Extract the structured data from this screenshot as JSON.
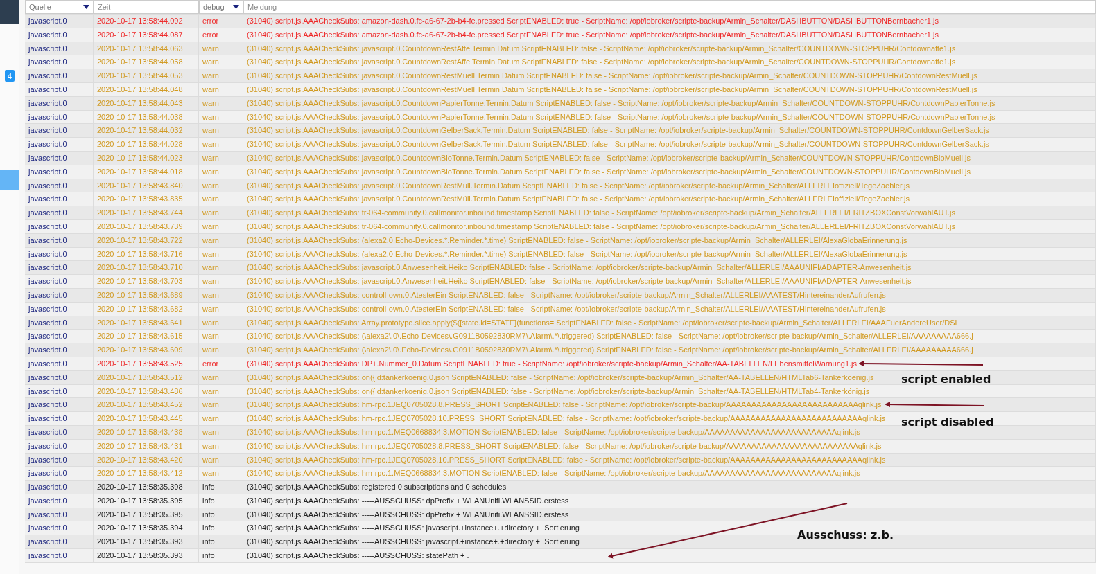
{
  "sidebar": {
    "badge": "4"
  },
  "filters": [
    {
      "kind": "select",
      "value": "Quelle"
    },
    {
      "kind": "input",
      "placeholder": "Zeit"
    },
    {
      "kind": "select",
      "value": "debug"
    },
    {
      "kind": "input",
      "placeholder": "Meldung"
    }
  ],
  "rows": [
    {
      "source": "javascript.0",
      "time": "2020-10-17 13:58:44.092",
      "severity": "error",
      "kind": "error",
      "message": "(31040) script.js.AAACheckSubs: amazon-dash.0.fc-a6-67-2b-b4-fe.pressed ScriptENABLED: true - ScriptName: /opt/iobroker/scripte-backup/Armin_Schalter/DASHBUTTON/DASHBUTTONBernbacher1.js"
    },
    {
      "source": "javascript.0",
      "time": "2020-10-17 13:58:44.087",
      "severity": "error",
      "kind": "error",
      "message": "(31040) script.js.AAACheckSubs: amazon-dash.0.fc-a6-67-2b-b4-fe.pressed ScriptENABLED: true - ScriptName: /opt/iobroker/scripte-backup/Armin_Schalter/DASHBUTTON/DASHBUTTONBernbacher1.js"
    },
    {
      "source": "javascript.0",
      "time": "2020-10-17 13:58:44.063",
      "severity": "warn",
      "kind": "warn",
      "message": "(31040) script.js.AAACheckSubs: javascript.0.CountdownRestAffe.Termin.Datum ScriptENABLED: false - ScriptName: /opt/iobroker/scripte-backup/Armin_Schalter/COUNTDOWN-STOPPUHR/Contdownaffe1.js"
    },
    {
      "source": "javascript.0",
      "time": "2020-10-17 13:58:44.058",
      "severity": "warn",
      "kind": "warn",
      "message": "(31040) script.js.AAACheckSubs: javascript.0.CountdownRestAffe.Termin.Datum ScriptENABLED: false - ScriptName: /opt/iobroker/scripte-backup/Armin_Schalter/COUNTDOWN-STOPPUHR/Contdownaffe1.js"
    },
    {
      "source": "javascript.0",
      "time": "2020-10-17 13:58:44.053",
      "severity": "warn",
      "kind": "warn",
      "message": "(31040) script.js.AAACheckSubs: javascript.0.CountdownRestMuell.Termin.Datum ScriptENABLED: false - ScriptName: /opt/iobroker/scripte-backup/Armin_Schalter/COUNTDOWN-STOPPUHR/ContdownRestMuell.js"
    },
    {
      "source": "javascript.0",
      "time": "2020-10-17 13:58:44.048",
      "severity": "warn",
      "kind": "warn",
      "message": "(31040) script.js.AAACheckSubs: javascript.0.CountdownRestMuell.Termin.Datum ScriptENABLED: false - ScriptName: /opt/iobroker/scripte-backup/Armin_Schalter/COUNTDOWN-STOPPUHR/ContdownRestMuell.js"
    },
    {
      "source": "javascript.0",
      "time": "2020-10-17 13:58:44.043",
      "severity": "warn",
      "kind": "warn",
      "message": "(31040) script.js.AAACheckSubs: javascript.0.CountdownPapierTonne.Termin.Datum ScriptENABLED: false - ScriptName: /opt/iobroker/scripte-backup/Armin_Schalter/COUNTDOWN-STOPPUHR/ContdownPapierTonne.js"
    },
    {
      "source": "javascript.0",
      "time": "2020-10-17 13:58:44.038",
      "severity": "warn",
      "kind": "warn",
      "message": "(31040) script.js.AAACheckSubs: javascript.0.CountdownPapierTonne.Termin.Datum ScriptENABLED: false - ScriptName: /opt/iobroker/scripte-backup/Armin_Schalter/COUNTDOWN-STOPPUHR/ContdownPapierTonne.js"
    },
    {
      "source": "javascript.0",
      "time": "2020-10-17 13:58:44.032",
      "severity": "warn",
      "kind": "warn",
      "message": "(31040) script.js.AAACheckSubs: javascript.0.CountdownGelberSack.Termin.Datum ScriptENABLED: false - ScriptName: /opt/iobroker/scripte-backup/Armin_Schalter/COUNTDOWN-STOPPUHR/ContdownGelberSack.js"
    },
    {
      "source": "javascript.0",
      "time": "2020-10-17 13:58:44.028",
      "severity": "warn",
      "kind": "warn",
      "message": "(31040) script.js.AAACheckSubs: javascript.0.CountdownGelberSack.Termin.Datum ScriptENABLED: false - ScriptName: /opt/iobroker/scripte-backup/Armin_Schalter/COUNTDOWN-STOPPUHR/ContdownGelberSack.js"
    },
    {
      "source": "javascript.0",
      "time": "2020-10-17 13:58:44.023",
      "severity": "warn",
      "kind": "warn",
      "message": "(31040) script.js.AAACheckSubs: javascript.0.CountdownBioTonne.Termin.Datum ScriptENABLED: false - ScriptName: /opt/iobroker/scripte-backup/Armin_Schalter/COUNTDOWN-STOPPUHR/ContdownBioMuell.js"
    },
    {
      "source": "javascript.0",
      "time": "2020-10-17 13:58:44.018",
      "severity": "warn",
      "kind": "warn",
      "message": "(31040) script.js.AAACheckSubs: javascript.0.CountdownBioTonne.Termin.Datum ScriptENABLED: false - ScriptName: /opt/iobroker/scripte-backup/Armin_Schalter/COUNTDOWN-STOPPUHR/ContdownBioMuell.js"
    },
    {
      "source": "javascript.0",
      "time": "2020-10-17 13:58:43.840",
      "severity": "warn",
      "kind": "warn",
      "message": "(31040) script.js.AAACheckSubs: javascript.0.CountdownRestMüll.Termin.Datum ScriptENABLED: false - ScriptName: /opt/iobroker/scripte-backup/Armin_Schalter/ALLERLEIoffiziell/TegeZaehler.js"
    },
    {
      "source": "javascript.0",
      "time": "2020-10-17 13:58:43.835",
      "severity": "warn",
      "kind": "warn",
      "message": "(31040) script.js.AAACheckSubs: javascript.0.CountdownRestMüll.Termin.Datum ScriptENABLED: false - ScriptName: /opt/iobroker/scripte-backup/Armin_Schalter/ALLERLEIoffiziell/TegeZaehler.js"
    },
    {
      "source": "javascript.0",
      "time": "2020-10-17 13:58:43.744",
      "severity": "warn",
      "kind": "warn",
      "message": "(31040) script.js.AAACheckSubs: tr-064-community.0.callmonitor.inbound.timestamp ScriptENABLED: false - ScriptName: /opt/iobroker/scripte-backup/Armin_Schalter/ALLERLEI/FRITZBOXConstVorwahlAUT.js"
    },
    {
      "source": "javascript.0",
      "time": "2020-10-17 13:58:43.739",
      "severity": "warn",
      "kind": "warn",
      "message": "(31040) script.js.AAACheckSubs: tr-064-community.0.callmonitor.inbound.timestamp ScriptENABLED: false - ScriptName: /opt/iobroker/scripte-backup/Armin_Schalter/ALLERLEI/FRITZBOXConstVorwahlAUT.js"
    },
    {
      "source": "javascript.0",
      "time": "2020-10-17 13:58:43.722",
      "severity": "warn",
      "kind": "warn",
      "message": "(31040) script.js.AAACheckSubs: (alexa2.0.Echo-Devices.*.Reminder.*.time) ScriptENABLED: false - ScriptName: /opt/iobroker/scripte-backup/Armin_Schalter/ALLERLEI/AlexaGlobaErinnerung.js"
    },
    {
      "source": "javascript.0",
      "time": "2020-10-17 13:58:43.716",
      "severity": "warn",
      "kind": "warn",
      "message": "(31040) script.js.AAACheckSubs: (alexa2.0.Echo-Devices.*.Reminder.*.time) ScriptENABLED: false - ScriptName: /opt/iobroker/scripte-backup/Armin_Schalter/ALLERLEI/AlexaGlobaErinnerung.js"
    },
    {
      "source": "javascript.0",
      "time": "2020-10-17 13:58:43.710",
      "severity": "warn",
      "kind": "warn",
      "message": "(31040) script.js.AAACheckSubs: javascript.0.Anwesenheit.Heiko ScriptENABLED: false - ScriptName: /opt/iobroker/scripte-backup/Armin_Schalter/ALLERLEI/AAAUNIFI/ADAPTER-Anwesenheit.js"
    },
    {
      "source": "javascript.0",
      "time": "2020-10-17 13:58:43.703",
      "severity": "warn",
      "kind": "warn",
      "message": "(31040) script.js.AAACheckSubs: javascript.0.Anwesenheit.Heiko ScriptENABLED: false - ScriptName: /opt/iobroker/scripte-backup/Armin_Schalter/ALLERLEI/AAAUNIFI/ADAPTER-Anwesenheit.js"
    },
    {
      "source": "javascript.0",
      "time": "2020-10-17 13:58:43.689",
      "severity": "warn",
      "kind": "warn",
      "message": "(31040) script.js.AAACheckSubs: controll-own.0.AtesterEin ScriptENABLED: false - ScriptName: /opt/iobroker/scripte-backup/Armin_Schalter/ALLERLEI/AAATEST/HintereinanderAufrufen.js"
    },
    {
      "source": "javascript.0",
      "time": "2020-10-17 13:58:43.682",
      "severity": "warn",
      "kind": "warn",
      "message": "(31040) script.js.AAACheckSubs: controll-own.0.AtesterEin ScriptENABLED: false - ScriptName: /opt/iobroker/scripte-backup/Armin_Schalter/ALLERLEI/AAATEST/HintereinanderAufrufen.js"
    },
    {
      "source": "javascript.0",
      "time": "2020-10-17 13:58:43.641",
      "severity": "warn",
      "kind": "warn",
      "message": "(31040) script.js.AAACheckSubs: Array.prototype.slice.apply($([state.id=STATE](functions= ScriptENABLED: false - ScriptName: /opt/iobroker/scripte-backup/Armin_Schalter/ALLERLEI/AAAFuerAndereUser/DSL"
    },
    {
      "source": "javascript.0",
      "time": "2020-10-17 13:58:43.615",
      "severity": "warn",
      "kind": "warn",
      "message": "(31040) script.js.AAACheckSubs: (\\alexa2\\.0\\.Echo-Devices\\.G0911B0592830RM7\\.Alarm\\.*\\.triggered) ScriptENABLED: false - ScriptName: /opt/iobroker/scripte-backup/Armin_Schalter/ALLERLEI/AAAAAAAAA666.j"
    },
    {
      "source": "javascript.0",
      "time": "2020-10-17 13:58:43.609",
      "severity": "warn",
      "kind": "warn",
      "message": "(31040) script.js.AAACheckSubs: (\\alexa2\\.0\\.Echo-Devices\\.G0911B0592830RM7\\.Alarm\\.*\\.triggered) ScriptENABLED: false - ScriptName: /opt/iobroker/scripte-backup/Armin_Schalter/ALLERLEI/AAAAAAAAA666.j"
    },
    {
      "source": "javascript.0",
      "time": "2020-10-17 13:58:43.525",
      "severity": "error",
      "kind": "error",
      "message": "(31040) script.js.AAACheckSubs: DP+.Nummer_0.Datum ScriptENABLED: true - ScriptName: /opt/iobroker/scripte-backup/Armin_Schalter/AA-TABELLEN/LEbensmittelWarnung1.js"
    },
    {
      "source": "javascript.0",
      "time": "2020-10-17 13:58:43.512",
      "severity": "warn",
      "kind": "warn",
      "message": "(31040) script.js.AAACheckSubs: on({id:tankerkoenig.0.json ScriptENABLED: false - ScriptName: /opt/iobroker/scripte-backup/Armin_Schalter/AA-TABELLEN/HTMLTab6-Tankerkoenig.js"
    },
    {
      "source": "javascript.0",
      "time": "2020-10-17 13:58:43.486",
      "severity": "warn",
      "kind": "warn",
      "message": "(31040) script.js.AAACheckSubs: on({id:tankerkoenig.0.json ScriptENABLED: false - ScriptName: /opt/iobroker/scripte-backup/Armin_Schalter/AA-TABELLEN/HTMLTab4-Tankerkönig.js"
    },
    {
      "source": "javascript.0",
      "time": "2020-10-17 13:58:43.452",
      "severity": "warn",
      "kind": "warn",
      "message": "(31040) script.js.AAACheckSubs: hm-rpc.1JEQ0705028.8.PRESS_SHORT ScriptENABLED: false - ScriptName: /opt/iobroker/scripte-backup/AAAAAAAAAAAAAAAAAAAAAAAAAAqlink.js"
    },
    {
      "source": "javascript.0",
      "time": "2020-10-17 13:58:43.445",
      "severity": "warn",
      "kind": "warn",
      "message": "(31040) script.js.AAACheckSubs: hm-rpc.1JEQ0705028.10.PRESS_SHORT ScriptENABLED: false - ScriptName: /opt/iobroker/scripte-backup/AAAAAAAAAAAAAAAAAAAAAAAAAAqlink.js"
    },
    {
      "source": "javascript.0",
      "time": "2020-10-17 13:58:43.438",
      "severity": "warn",
      "kind": "warn",
      "message": "(31040) script.js.AAACheckSubs: hm-rpc.1.MEQ0668834.3.MOTION ScriptENABLED: false - ScriptName: /opt/iobroker/scripte-backup/AAAAAAAAAAAAAAAAAAAAAAAAAAqlink.js"
    },
    {
      "source": "javascript.0",
      "time": "2020-10-17 13:58:43.431",
      "severity": "warn",
      "kind": "warn",
      "message": "(31040) script.js.AAACheckSubs: hm-rpc.1JEQ0705028.8.PRESS_SHORT ScriptENABLED: false - ScriptName: /opt/iobroker/scripte-backup/AAAAAAAAAAAAAAAAAAAAAAAAAAqlink.js"
    },
    {
      "source": "javascript.0",
      "time": "2020-10-17 13:58:43.420",
      "severity": "warn",
      "kind": "warn",
      "message": "(31040) script.js.AAACheckSubs: hm-rpc.1JEQ0705028.10.PRESS_SHORT ScriptENABLED: false - ScriptName: /opt/iobroker/scripte-backup/AAAAAAAAAAAAAAAAAAAAAAAAAAqlink.js"
    },
    {
      "source": "javascript.0",
      "time": "2020-10-17 13:58:43.412",
      "severity": "warn",
      "kind": "warn",
      "message": "(31040) script.js.AAACheckSubs: hm-rpc.1.MEQ0668834.3.MOTION ScriptENABLED: false - ScriptName: /opt/iobroker/scripte-backup/AAAAAAAAAAAAAAAAAAAAAAAAAAqlink.js"
    },
    {
      "source": "javascript.0",
      "time": "2020-10-17 13:58:35.398",
      "severity": "info",
      "kind": "info",
      "message": "(31040) script.js.AAACheckSubs: registered 0 subscriptions and 0 schedules"
    },
    {
      "source": "javascript.0",
      "time": "2020-10-17 13:58:35.395",
      "severity": "info",
      "kind": "info",
      "message": "(31040) script.js.AAACheckSubs: -----AUSSCHUSS: dpPrefix + WLANUnifi.WLANSSID.erstess"
    },
    {
      "source": "javascript.0",
      "time": "2020-10-17 13:58:35.395",
      "severity": "info",
      "kind": "info",
      "message": "(31040) script.js.AAACheckSubs: -----AUSSCHUSS: dpPrefix + WLANUnifi.WLANSSID.erstess"
    },
    {
      "source": "javascript.0",
      "time": "2020-10-17 13:58:35.394",
      "severity": "info",
      "kind": "info",
      "message": "(31040) script.js.AAACheckSubs: -----AUSSCHUSS: javascript.+instance+.+directory + .Sortierung"
    },
    {
      "source": "javascript.0",
      "time": "2020-10-17 13:58:35.393",
      "severity": "info",
      "kind": "info",
      "message": "(31040) script.js.AAACheckSubs: -----AUSSCHUSS: javascript.+instance+.+directory + .Sortierung"
    },
    {
      "source": "javascript.0",
      "time": "2020-10-17 13:58:35.393",
      "severity": "info",
      "kind": "info",
      "message": "(31040) script.js.AAACheckSubs: -----AUSSCHUSS: statePath + ."
    }
  ],
  "annotations": [
    {
      "text": "script enabled"
    },
    {
      "text": "script disabled"
    },
    {
      "text": "Ausschuss: z.b."
    }
  ]
}
